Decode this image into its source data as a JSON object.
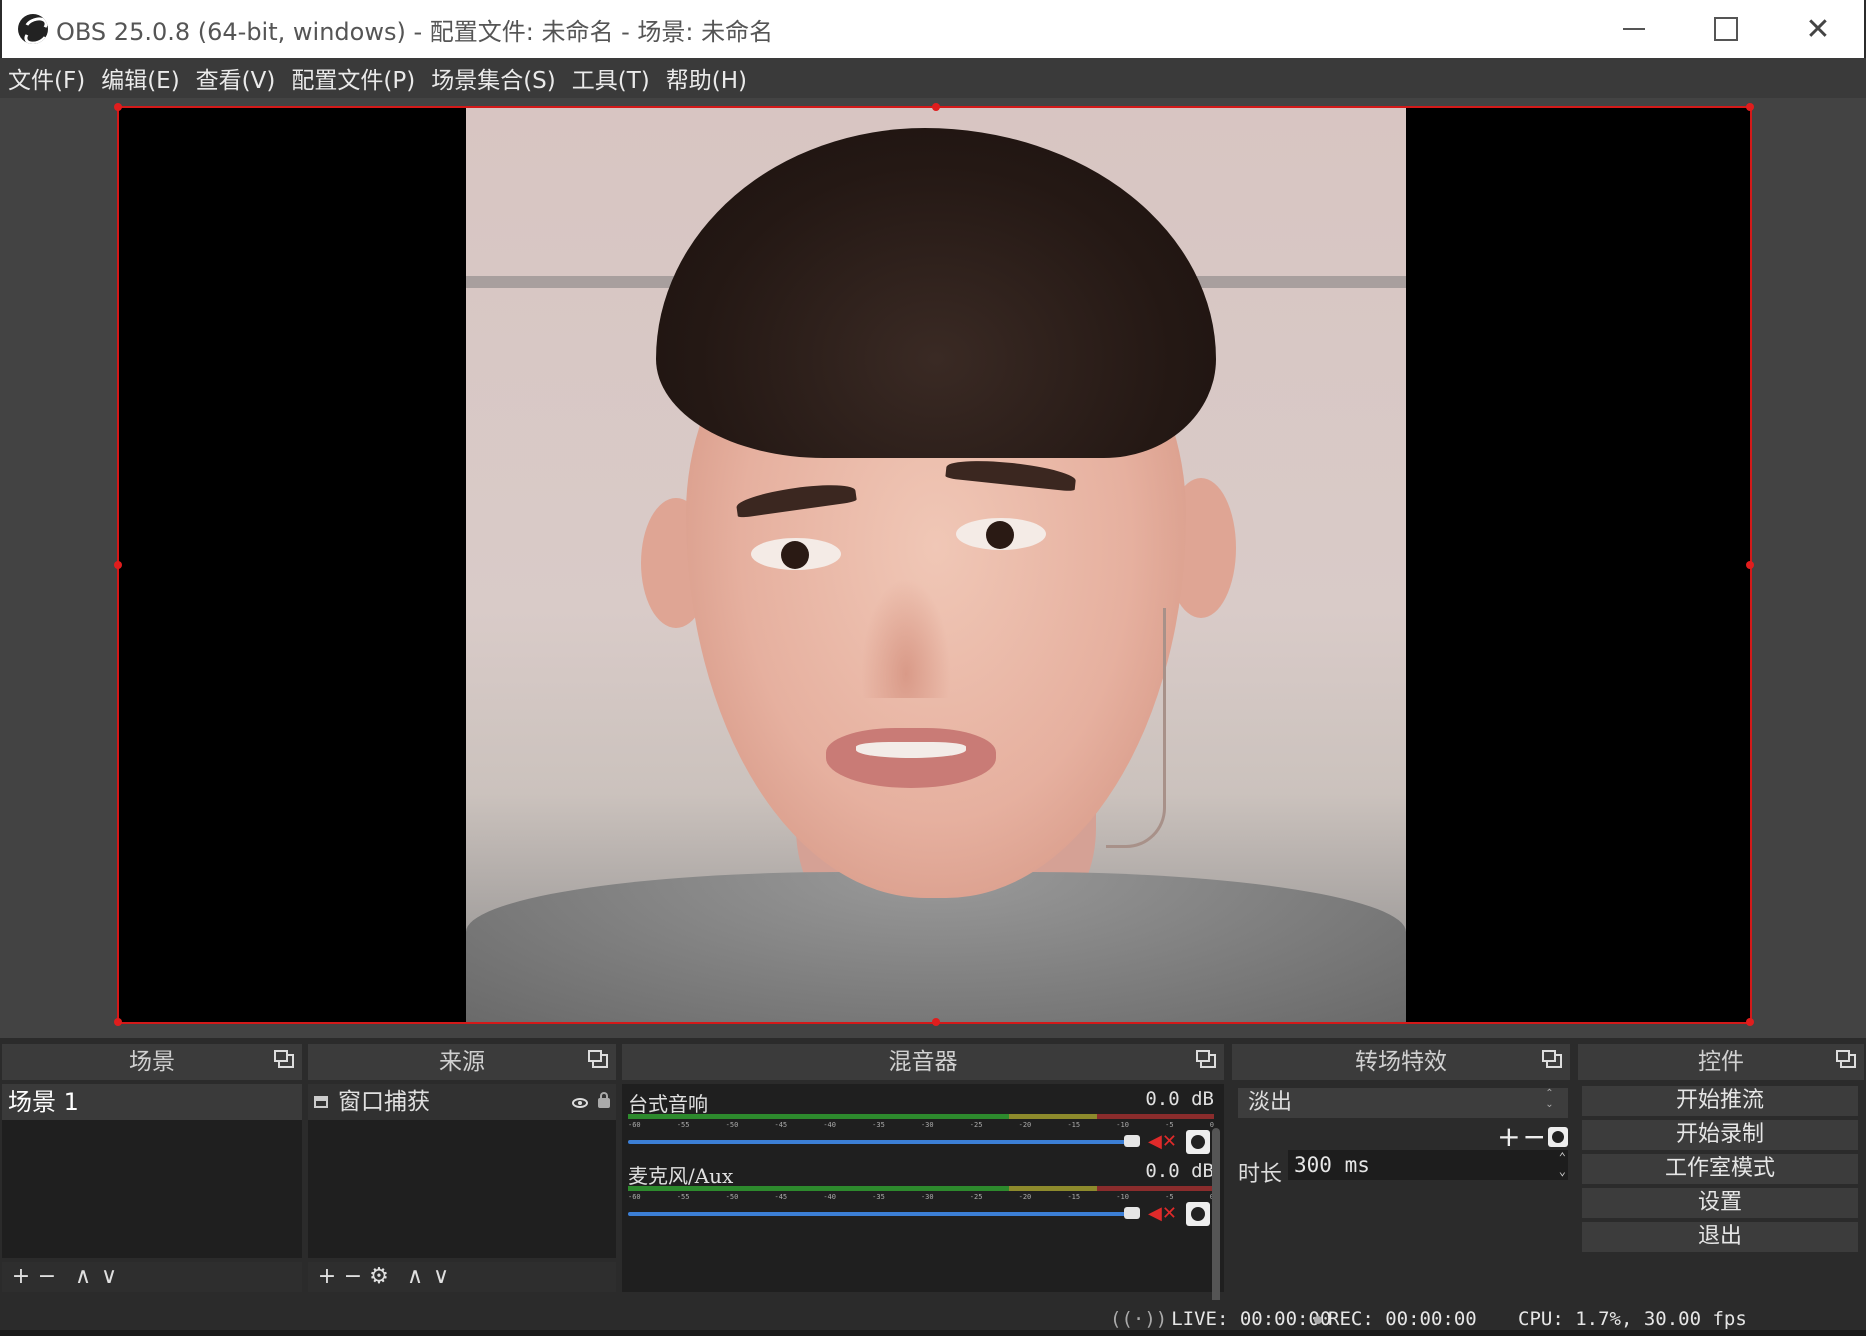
{
  "window": {
    "title": "OBS 25.0.8 (64-bit, windows) - 配置文件: 未命名 - 场景: 未命名",
    "minimize": "",
    "maximize": "",
    "close": "✕"
  },
  "menu": [
    "文件(F)",
    "编辑(E)",
    "查看(V)",
    "配置文件(P)",
    "场景集合(S)",
    "工具(T)",
    "帮助(H)"
  ],
  "docks": {
    "scenes": {
      "title": "场景",
      "items": [
        "场景 1"
      ],
      "toolbar": [
        "+",
        "−",
        "∧",
        "∨"
      ]
    },
    "sources": {
      "title": "来源",
      "items": [
        "窗口捕获"
      ],
      "toolbar": [
        "+",
        "−",
        "⚙",
        "∧",
        "∨"
      ]
    },
    "mixer": {
      "title": "混音器",
      "channels": [
        {
          "name": "台式音响",
          "db": "0.0 dB",
          "volume": 1.0,
          "muted": true
        },
        {
          "name": "麦克风/Aux",
          "db": "0.0 dB",
          "volume": 1.0,
          "muted": true
        }
      ],
      "ticks": [
        "-60",
        "-55",
        "-50",
        "-45",
        "-40",
        "-35",
        "-30",
        "-25",
        "-20",
        "-15",
        "-10",
        "-5",
        "0"
      ]
    },
    "transitions": {
      "title": "转场特效",
      "selected": "淡出",
      "duration_label": "时长",
      "duration_value": "300 ms",
      "add": "+",
      "remove": "−"
    },
    "controls": {
      "title": "控件",
      "buttons": [
        "开始推流",
        "开始录制",
        "工作室模式",
        "设置",
        "退出"
      ]
    }
  },
  "status": {
    "live": "LIVE: 00:00:00",
    "rec": "REC: 00:00:00",
    "cpu": "CPU: 1.7%, 30.00 fps"
  },
  "colors": {
    "selection_border": "#d31919",
    "fader": "#3c7fd6",
    "mute": "#e02a2a"
  }
}
